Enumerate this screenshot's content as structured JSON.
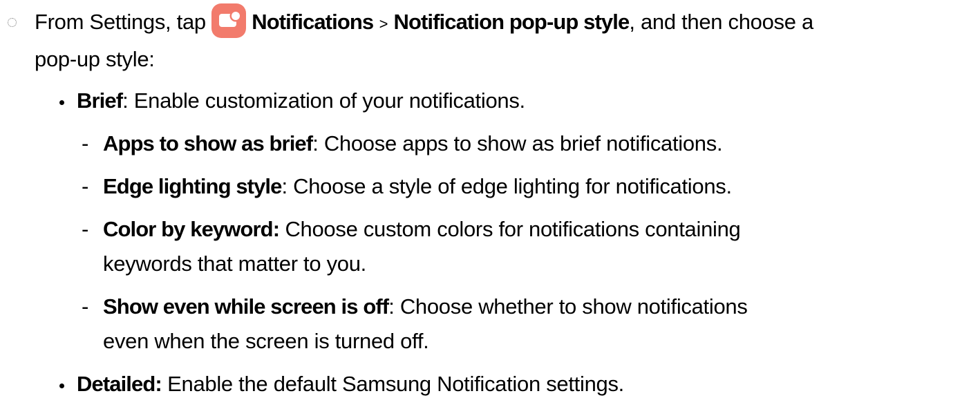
{
  "step": {
    "prefix": "From Settings, tap",
    "icon": "notifications-app-icon",
    "icon_color": "#F27B6C",
    "path_1": "Notifications",
    "separator": ">",
    "path_2": "Notification pop-up style",
    "suffix": ", and then choose a",
    "continuation": "pop-up style:"
  },
  "options": [
    {
      "label": "Brief",
      "desc": ": Enable customization of your notifications.",
      "suboptions": [
        {
          "dash": "-",
          "label": "Apps to show as brief",
          "desc": ": Choose apps to show as brief notifications."
        },
        {
          "dash": "-",
          "label": "Edge lighting style",
          "desc": ": Choose a style of edge lighting for notifications."
        },
        {
          "dash": "-",
          "label": "Color by keyword:",
          "desc": " Choose custom colors for notifications containing",
          "desc_continued": "keywords that matter to you."
        },
        {
          "dash": "-",
          "label": "Show even while screen is off",
          "desc": ": Choose whether to show notifications",
          "desc_continued": "even when the screen is turned off."
        }
      ]
    },
    {
      "label": "Detailed:",
      "desc": " Enable the default Samsung Notification settings."
    }
  ]
}
